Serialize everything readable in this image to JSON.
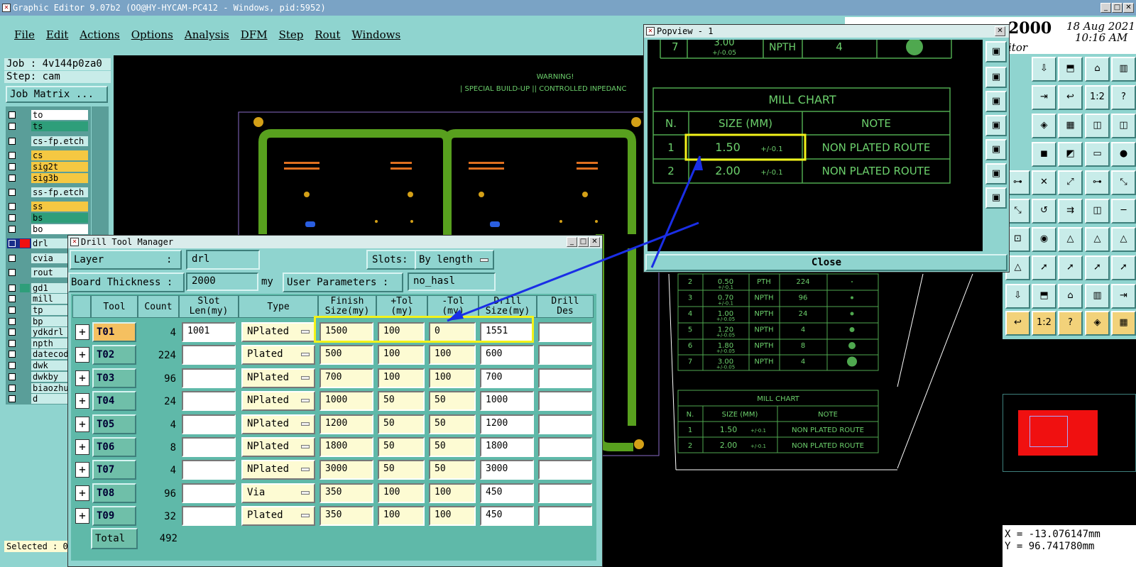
{
  "app": {
    "title": "Graphic Editor 9.07b2 (OO@HY-HYCAM-PC412 - Windows, pid:5952)",
    "date": "18 Aug 2021",
    "time": "10:16 AM",
    "brand_fragment": "2000",
    "edit_fragment": "itor"
  },
  "menu": [
    "File",
    "Edit",
    "Actions",
    "Options",
    "Analysis",
    "DFM",
    "Step",
    "Rout",
    "Windows"
  ],
  "job": {
    "job_label": "Job : 4v144p0za0",
    "step_label": "Step: cam",
    "matrix_button": "Job Matrix ..."
  },
  "layers": [
    {
      "name": "to",
      "color": "#ffffff"
    },
    {
      "name": "ts",
      "color": "#2e9e7a"
    },
    {
      "name": "cs-fp.etch",
      "color": "#c8ece9"
    },
    {
      "name": "cs",
      "color": "#f5c842"
    },
    {
      "name": "sig2t",
      "color": "#f5c842"
    },
    {
      "name": "sig3b",
      "color": "#f5c842"
    },
    {
      "name": "ss-fp.etch",
      "color": "#c8ece9"
    },
    {
      "name": "ss",
      "color": "#f5c842"
    },
    {
      "name": "bs",
      "color": "#2e9e7a"
    },
    {
      "name": "bo",
      "color": "#ffffff"
    },
    {
      "name": "drl",
      "color": "#c8ece9"
    },
    {
      "name": "cvia",
      "color": "#c8ece9"
    },
    {
      "name": "rout",
      "color": "#c8ece9"
    },
    {
      "name": "gd1",
      "color": "#c8ece9"
    },
    {
      "name": "mill",
      "color": "#c8ece9"
    },
    {
      "name": "tp",
      "color": "#c8ece9"
    },
    {
      "name": "bp",
      "color": "#c8ece9"
    },
    {
      "name": "ydkdrl",
      "color": "#c8ece9"
    },
    {
      "name": "npth",
      "color": "#c8ece9"
    },
    {
      "name": "datecode",
      "color": "#c8ece9"
    },
    {
      "name": "dwk",
      "color": "#c8ece9"
    },
    {
      "name": "dwkby",
      "color": "#c8ece9"
    },
    {
      "name": "biaozhun",
      "color": "#c8ece9"
    },
    {
      "name": "d",
      "color": "#c8ece9"
    }
  ],
  "selected_label": "Selected : 0",
  "canvas": {
    "warning_1": "WARNING!",
    "warning_2": "| SPECIAL BUILD-UP || CONTROLLED INPEDANC"
  },
  "drill_table_bg": [
    {
      "n": "2",
      "size": "0.50",
      "tol": "+/-0.1",
      "type": "PTH",
      "count": "224"
    },
    {
      "n": "3",
      "size": "0.70",
      "tol": "+/-0.1",
      "type": "NPTH",
      "count": "96"
    },
    {
      "n": "4",
      "size": "1.00",
      "tol": "+/-0.05",
      "type": "NPTH",
      "count": "24"
    },
    {
      "n": "5",
      "size": "1.20",
      "tol": "+/-0.05",
      "type": "NPTH",
      "count": "4"
    },
    {
      "n": "6",
      "size": "1.80",
      "tol": "+/-0.05",
      "type": "NPTH",
      "count": "8"
    },
    {
      "n": "7",
      "size": "3.00",
      "tol": "+/-0.05",
      "type": "NPTH",
      "count": "4"
    }
  ],
  "mill_chart": {
    "title": "MILL CHART",
    "headers": [
      "N.",
      "SIZE (MM)",
      "NOTE"
    ],
    "rows": [
      {
        "n": "1",
        "size": "1.50",
        "tol": "+/-0.1",
        "note": "NON PLATED ROUTE"
      },
      {
        "n": "2",
        "size": "2.00",
        "tol": "+/-0.1",
        "note": "NON PLATED ROUTE"
      }
    ]
  },
  "popview": {
    "title": "Popview - 1",
    "top_row": {
      "n": "7",
      "size": "3.00",
      "tol": "+/-0.05",
      "type": "NPTH",
      "count": "4"
    },
    "close": "Close"
  },
  "coords": {
    "x": "X = -13.076147mm",
    "y": "Y =  96.741780mm"
  },
  "dtm": {
    "title": "Drill Tool Manager",
    "layer_label": "Layer",
    "layer_colon": ":",
    "layer_value": "drl",
    "slots_label": "Slots:",
    "slots_value": "By length",
    "thickness_label": "Board Thickness :",
    "thickness_value": "2000",
    "thickness_unit": "my",
    "user_params_label": "User Parameters :",
    "user_params_value": "no_hasl",
    "headers": {
      "tool": "Tool",
      "count": "Count",
      "slot": "Slot\nLen(my)",
      "type": "Type",
      "finish": "Finish\nSize(my)",
      "ptol": "+Tol\n(my)",
      "ntol": "-Tol\n(my)",
      "drill": "Drill\nSize(my)",
      "des": "Drill\nDes"
    },
    "rows": [
      {
        "tool": "T01",
        "count": "4",
        "slot": "1001",
        "type": "NPlated",
        "finish": "1500",
        "ptol": "100",
        "ntol": "0",
        "drill": "1551"
      },
      {
        "tool": "T02",
        "count": "224",
        "slot": "",
        "type": "Plated",
        "finish": "500",
        "ptol": "100",
        "ntol": "100",
        "drill": "600"
      },
      {
        "tool": "T03",
        "count": "96",
        "slot": "",
        "type": "NPlated",
        "finish": "700",
        "ptol": "100",
        "ntol": "100",
        "drill": "700"
      },
      {
        "tool": "T04",
        "count": "24",
        "slot": "",
        "type": "NPlated",
        "finish": "1000",
        "ptol": "50",
        "ntol": "50",
        "drill": "1000"
      },
      {
        "tool": "T05",
        "count": "4",
        "slot": "",
        "type": "NPlated",
        "finish": "1200",
        "ptol": "50",
        "ntol": "50",
        "drill": "1200"
      },
      {
        "tool": "T06",
        "count": "8",
        "slot": "",
        "type": "NPlated",
        "finish": "1800",
        "ptol": "50",
        "ntol": "50",
        "drill": "1800"
      },
      {
        "tool": "T07",
        "count": "4",
        "slot": "",
        "type": "NPlated",
        "finish": "3000",
        "ptol": "50",
        "ntol": "50",
        "drill": "3000"
      },
      {
        "tool": "T08",
        "count": "96",
        "slot": "",
        "type": "Via",
        "finish": "350",
        "ptol": "100",
        "ntol": "100",
        "drill": "450"
      },
      {
        "tool": "T09",
        "count": "32",
        "slot": "",
        "type": "Plated",
        "finish": "350",
        "ptol": "100",
        "ntol": "100",
        "drill": "450"
      }
    ],
    "total_label": "Total",
    "total_value": "492"
  }
}
